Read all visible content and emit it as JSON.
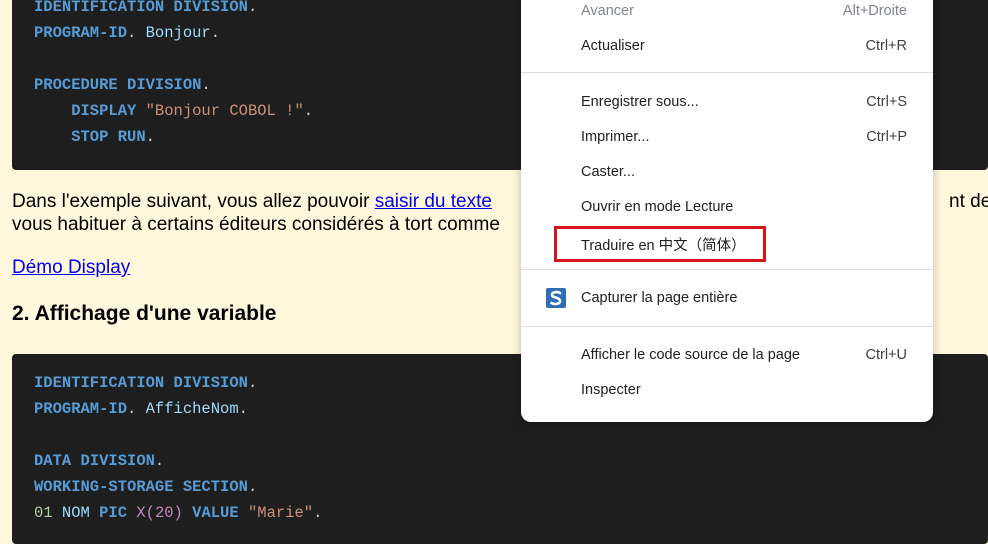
{
  "code_block_1": {
    "lines": [
      [
        {
          "t": "IDENTIFICATION DIVISION",
          "c": "kw"
        },
        {
          "t": ".",
          "c": "punct"
        }
      ],
      [
        {
          "t": "PROGRAM-ID",
          "c": "kw"
        },
        {
          "t": ". ",
          "c": "punct"
        },
        {
          "t": "Bonjour",
          "c": "ident"
        },
        {
          "t": ".",
          "c": "punct"
        }
      ],
      [],
      [
        {
          "t": "PROCEDURE DIVISION",
          "c": "kw"
        },
        {
          "t": ".",
          "c": "punct"
        }
      ],
      [
        {
          "t": "    DISPLAY ",
          "c": "kw"
        },
        {
          "t": "\"Bonjour COBOL !\"",
          "c": "str"
        },
        {
          "t": ".",
          "c": "punct"
        }
      ],
      [
        {
          "t": "    STOP RUN",
          "c": "kw"
        },
        {
          "t": ".",
          "c": "punct"
        }
      ]
    ]
  },
  "paragraph": {
    "line1_before": "Dans l'exemple suivant, vous allez pouvoir ",
    "line1_link": "saisir du texte",
    "line1_after_menu": "nt des",
    "line2": "vous habituer à certains éditeurs considérés à tort comme"
  },
  "demo_link": "Démo Display",
  "section_heading": "2. Affichage d'une variable",
  "code_block_2": {
    "lines": [
      [
        {
          "t": "IDENTIFICATION DIVISION",
          "c": "kw"
        },
        {
          "t": ".",
          "c": "punct"
        }
      ],
      [
        {
          "t": "PROGRAM-ID",
          "c": "kw"
        },
        {
          "t": ". ",
          "c": "punct"
        },
        {
          "t": "AfficheNom",
          "c": "ident"
        },
        {
          "t": ".",
          "c": "punct"
        }
      ],
      [],
      [
        {
          "t": "DATA DIVISION",
          "c": "kw"
        },
        {
          "t": ".",
          "c": "punct"
        }
      ],
      [
        {
          "t": "WORKING-STORAGE SECTION",
          "c": "kw"
        },
        {
          "t": ".",
          "c": "punct"
        }
      ],
      [
        {
          "t": "01 ",
          "c": "num"
        },
        {
          "t": "NOM ",
          "c": "ident"
        },
        {
          "t": "PIC ",
          "c": "kw"
        },
        {
          "t": "X(20) ",
          "c": "type"
        },
        {
          "t": "VALUE ",
          "c": "kw"
        },
        {
          "t": "\"Marie\"",
          "c": "str"
        },
        {
          "t": ".",
          "c": "punct"
        }
      ]
    ]
  },
  "context_menu": {
    "avancer": {
      "label": "Avancer",
      "shortcut": "Alt+Droite"
    },
    "actualiser": {
      "label": "Actualiser",
      "shortcut": "Ctrl+R"
    },
    "enregistrer": {
      "label": "Enregistrer sous...",
      "shortcut": "Ctrl+S"
    },
    "imprimer": {
      "label": "Imprimer...",
      "shortcut": "Ctrl+P"
    },
    "caster": {
      "label": "Caster..."
    },
    "lecture": {
      "label": "Ouvrir en mode Lecture"
    },
    "traduire": {
      "label": "Traduire en 中文（简体）"
    },
    "capturer": {
      "label": "Capturer la page entière",
      "icon": "screenshot-s-icon"
    },
    "source": {
      "label": "Afficher le code source de la page",
      "shortcut": "Ctrl+U"
    },
    "inspecter": {
      "label": "Inspecter"
    }
  },
  "colors": {
    "highlight_border": "#d9151c",
    "page_bg": "#fff8dc",
    "code_bg": "#1e1e1e",
    "link": "#0000ee"
  }
}
